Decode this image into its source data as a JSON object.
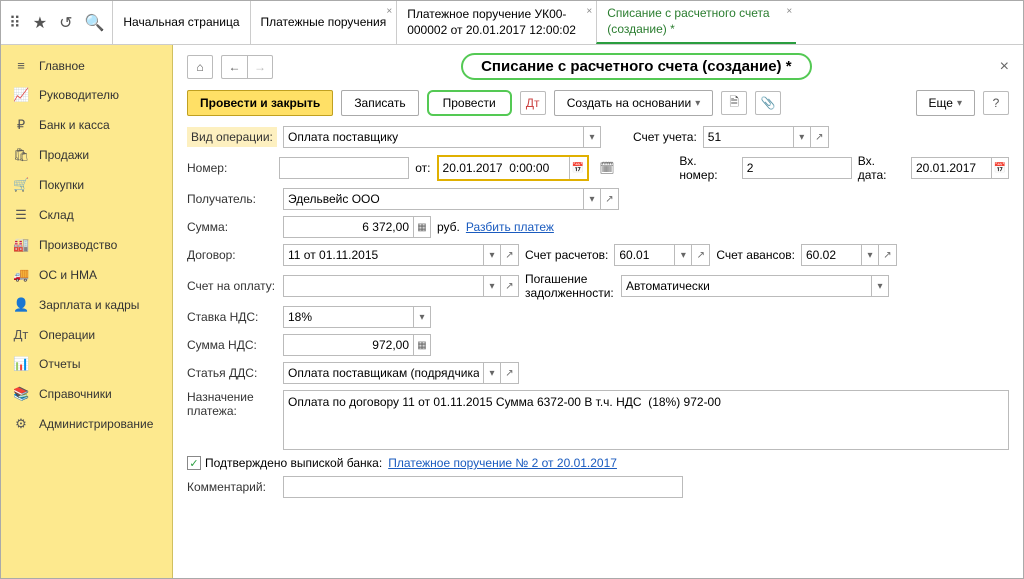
{
  "tabs": [
    {
      "label": "Начальная страница"
    },
    {
      "label": "Платежные поручения"
    },
    {
      "label": "Платежное поручение УК00-000002 от 20.01.2017 12:00:02"
    },
    {
      "label": "Списание с расчетного счета (создание) *"
    }
  ],
  "nav": [
    {
      "icon": "≡",
      "label": "Главное"
    },
    {
      "icon": "📈",
      "label": "Руководителю"
    },
    {
      "icon": "₽",
      "label": "Банк и касса"
    },
    {
      "icon": "🛍",
      "label": "Продажи"
    },
    {
      "icon": "🛒",
      "label": "Покупки"
    },
    {
      "icon": "☰",
      "label": "Склад"
    },
    {
      "icon": "🏭",
      "label": "Производство"
    },
    {
      "icon": "🚚",
      "label": "ОС и НМА"
    },
    {
      "icon": "👤",
      "label": "Зарплата и кадры"
    },
    {
      "icon": "Дт",
      "label": "Операции"
    },
    {
      "icon": "📊",
      "label": "Отчеты"
    },
    {
      "icon": "📚",
      "label": "Справочники"
    },
    {
      "icon": "⚙",
      "label": "Администрирование"
    }
  ],
  "title": "Списание с расчетного счета (создание) *",
  "toolbar": {
    "post_close": "Провести и закрыть",
    "save": "Записать",
    "post": "Провести",
    "create_based": "Создать на основании",
    "more": "Еще"
  },
  "form": {
    "op_type_label": "Вид операции:",
    "op_type": "Оплата поставщику",
    "account_label": "Счет учета:",
    "account": "51",
    "number_label": "Номер:",
    "number": "",
    "from_label": "от:",
    "date": "20.01.2017  0:00:00",
    "in_number_label": "Вх. номер:",
    "in_number": "2",
    "in_date_label": "Вх. дата:",
    "in_date": "20.01.2017",
    "recipient_label": "Получатель:",
    "recipient": "Эдельвейс ООО",
    "sum_label": "Сумма:",
    "sum": "6 372,00",
    "currency": "руб.",
    "split_link": "Разбить платеж",
    "contract_label": "Договор:",
    "contract": "11 от 01.11.2015",
    "calc_account_label": "Счет расчетов:",
    "calc_account": "60.01",
    "advance_account_label": "Счет авансов:",
    "advance_account": "60.02",
    "invoice_label": "Счет на оплату:",
    "invoice": "",
    "debt_label": "Погашение задолженности:",
    "debt": "Автоматически",
    "vat_rate_label": "Ставка НДС:",
    "vat_rate": "18%",
    "vat_sum_label": "Сумма НДС:",
    "vat_sum": "972,00",
    "dds_label": "Статья ДДС:",
    "dds": "Оплата поставщикам (подрядчикам)",
    "purpose_label": "Назначение платежа:",
    "purpose": "Оплата по договору 11 от 01.11.2015 Сумма 6372-00 В т.ч. НДС  (18%) 972-00",
    "confirmed_label": "Подтверждено выпиской банка:",
    "confirmed_link": "Платежное поручение № 2 от 20.01.2017",
    "comment_label": "Комментарий:",
    "comment": ""
  }
}
